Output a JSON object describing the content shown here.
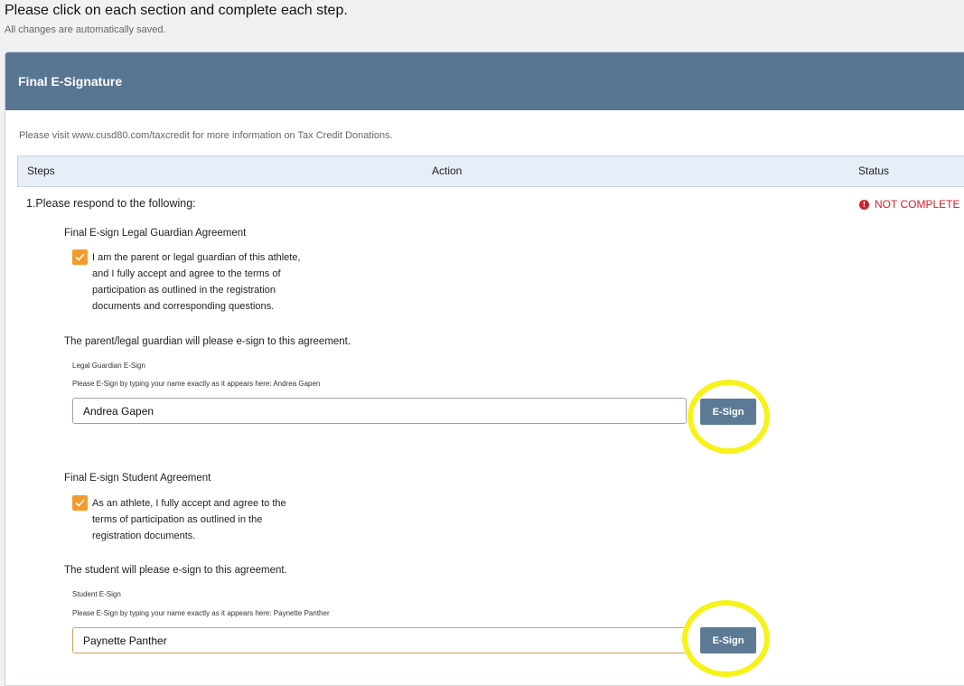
{
  "page": {
    "title": "Please click on each section and complete each step.",
    "subtitle": "All changes are automatically saved."
  },
  "section": {
    "title": "Final E-Signature",
    "info": "Please visit www.cusd80.com/taxcredit for more information on Tax Credit Donations."
  },
  "table": {
    "columns": [
      "Steps",
      "Action",
      "Status"
    ]
  },
  "step": {
    "title": "1.Please respond to the following:",
    "status": "NOT COMPLETE",
    "status_color": "#d0202b"
  },
  "guardian": {
    "heading": "Final E-sign Legal Guardian Agreement",
    "checked": true,
    "agreement": "I am the parent or legal guardian of this athlete,\nand I fully accept and agree to the terms of\nparticipation as outlined in the registration\ndocuments and corresponding questions.",
    "instruction": "The parent/legal guardian will please e-sign to this agreement.",
    "field_label": "Legal Guardian E-Sign",
    "field_hint": "Please E-Sign by typing your name exactly as it appears here: Andrea Gapen",
    "value": "Andrea Gapen",
    "button": "E-Sign"
  },
  "student": {
    "heading": "Final E-sign Student Agreement",
    "checked": true,
    "agreement": "As an athlete, I fully accept and agree to the\nterms of participation as outlined in the\nregistration documents.",
    "instruction": "The student will please e-sign to this agreement.",
    "field_label": "Student E-Sign",
    "field_hint": "Please E-Sign by typing your name exactly as it appears here: Paynette Panther",
    "value": "Paynette Panther",
    "button": "E-Sign"
  },
  "colors": {
    "header_bg": "#587691",
    "checkbox": "#f39a2b",
    "button": "#5c7a94",
    "highlight": "#f6f21a"
  },
  "icons": {
    "status": "exclamation-circle-icon",
    "checkbox": "checkmark-icon"
  }
}
